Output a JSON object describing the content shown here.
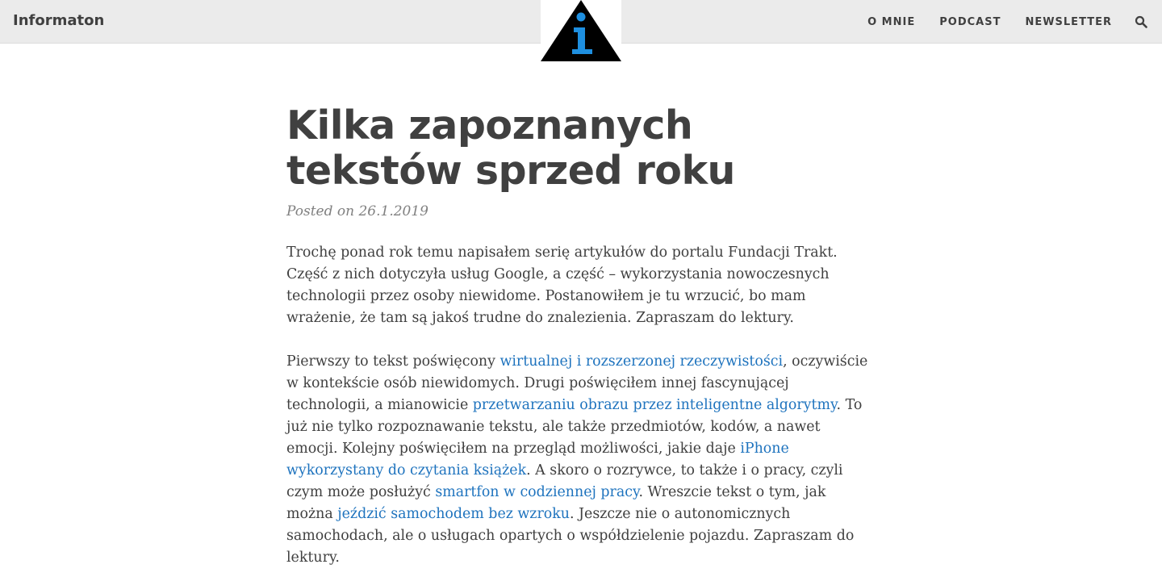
{
  "nav": {
    "brand": "Informaton",
    "links": [
      "O MNIE",
      "PODCAST",
      "NEWSLETTER"
    ],
    "search_icon": "search-icon",
    "logo_icon": "info-triangle-logo"
  },
  "post": {
    "title": "Kilka zapoznanych tekstów sprzed roku",
    "meta": "Posted on 26.1.2019",
    "p1": "Trochę ponad rok temu napisałem serię artykułów do portalu Fundacji Trakt. Część z nich dotyczyła usług Google, a część – wykorzystania nowoczesnych technologii przez osoby niewidome. Postanowiłem je tu wrzucić, bo mam wrażenie, że tam są jakoś trudne do znalezienia. Zapraszam do lektury.",
    "p2": {
      "t1": "Pierwszy to tekst poświęcony ",
      "l1": "wirtualnej i rozszerzonej rzeczywistości",
      "t2": ", oczywiście w kontekście osób niewidomych. Drugi poświęciłem innej fascynującej technologii, a mianowicie ",
      "l2": "przetwarzaniu obrazu przez inteligentne algorytmy",
      "t3": ". To już nie tylko rozpoznawanie tekstu, ale także przedmiotów, kodów, a nawet emocji. Kolejny poświęciłem na przegląd możliwości, jakie daje ",
      "l3": "iPhone wykorzystany do czytania książek",
      "t4": ". A skoro o rozrywce, to także i o pracy, czyli czym może posłużyć ",
      "l4": "smartfon w codziennej pracy",
      "t5": ". Wreszcie tekst o tym, jak można ",
      "l5": "jeździć samochodem bez wzroku",
      "t6": ". Jeszcze nie o autonomicznych samochodach, ale o usługach opartych o współdzielenie pojazdu. Zapraszam do lektury."
    }
  },
  "colors": {
    "navbar_bg": "#ebebeb",
    "text": "#404040",
    "link": "#1e73be",
    "meta": "#808080",
    "logo_accent": "#1e8fe0"
  }
}
